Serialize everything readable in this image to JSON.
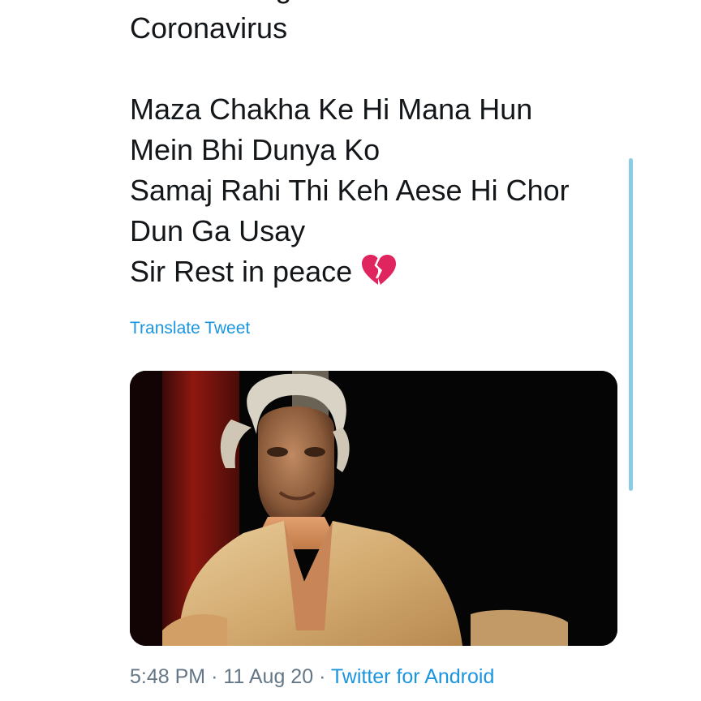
{
  "tweet": {
    "text_lines": [
      "After Testing Positive For",
      "Coronavirus",
      "",
      "Maza Chakha Ke Hi Mana Hun",
      "Mein Bhi Dunya Ko",
      "Samaj Rahi Thi Keh Aese Hi Chor",
      "Dun Ga Usay",
      "Sir Rest in peace"
    ],
    "emoji": "broken-heart-icon",
    "translate_label": "Translate Tweet",
    "time": "5:48 PM",
    "separator": "·",
    "date": "11 Aug 20",
    "source": "Twitter for Android"
  },
  "colors": {
    "text": "#14171a",
    "link": "#1b95e0",
    "meta": "#657786",
    "heart": "#e0245e",
    "scrollbar": "#8ccbe6"
  }
}
